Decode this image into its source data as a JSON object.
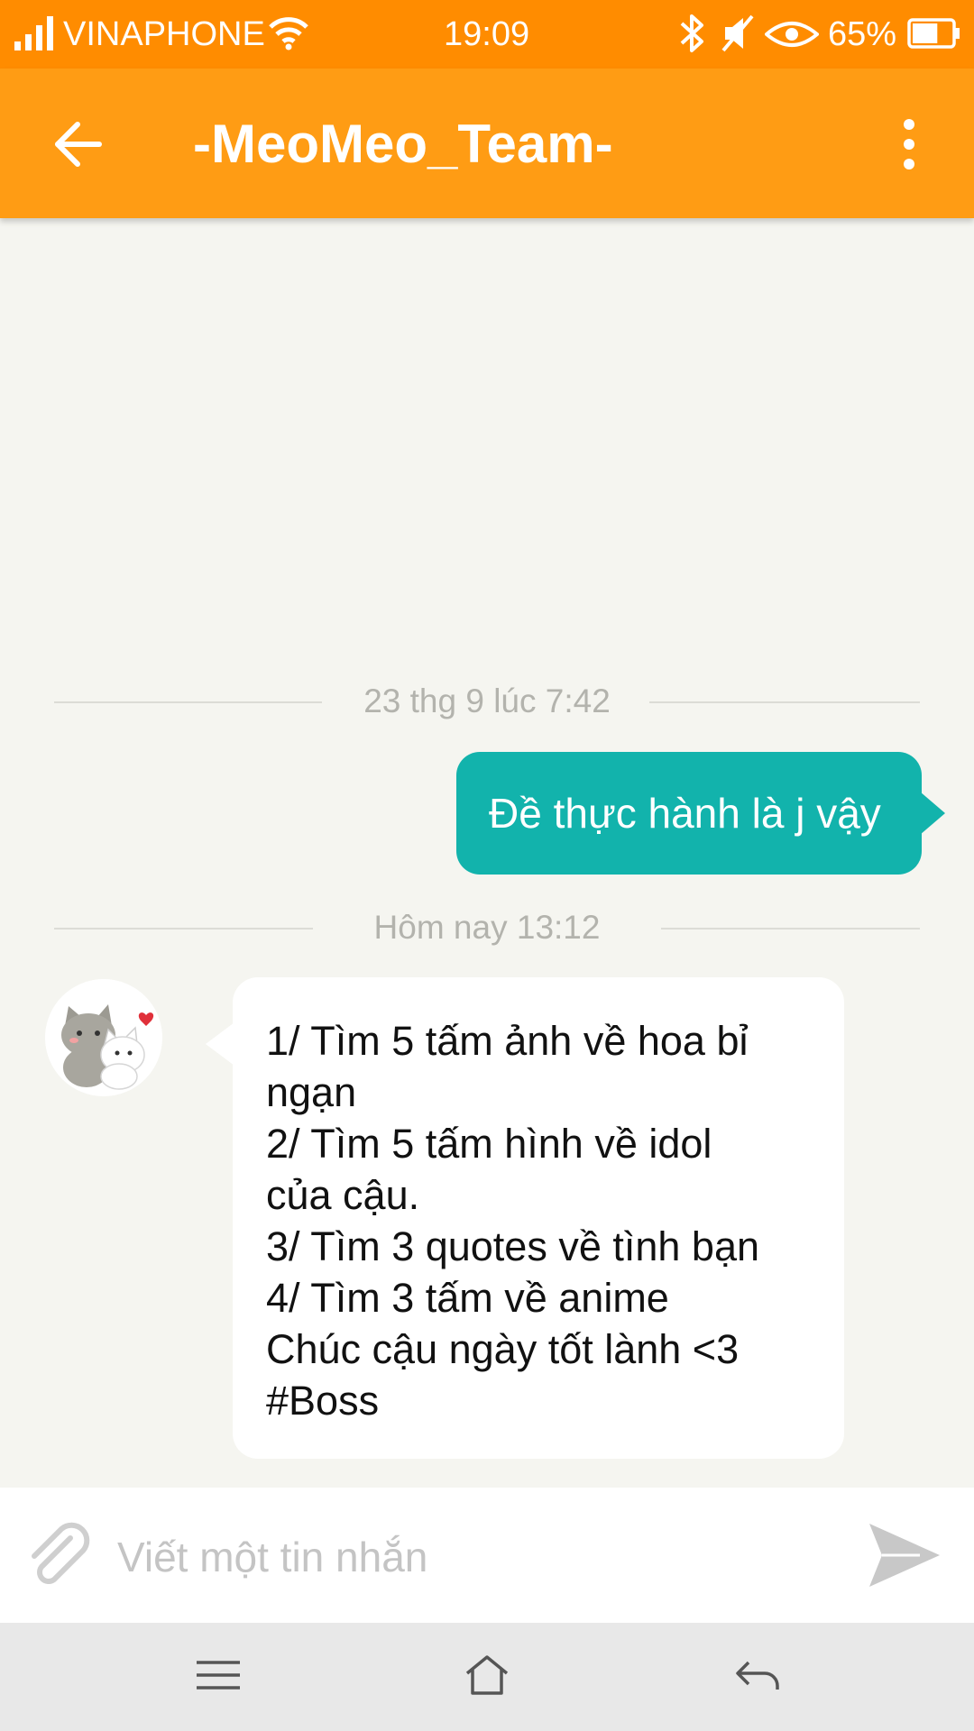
{
  "status_bar": {
    "carrier": "VINAPHONE",
    "time": "19:09",
    "battery_percent": "65%",
    "battery_level": 0.65,
    "icons": [
      "signal-icon",
      "wifi-icon",
      "bluetooth-icon",
      "mute-icon",
      "eye-icon",
      "battery-icon"
    ]
  },
  "header": {
    "title": "-MeoMeo_Team-",
    "back_icon": "arrow-left-icon",
    "menu_icon": "more-vertical-icon"
  },
  "conversation": {
    "separators": [
      {
        "label": "23 thg 9 lúc 7:42"
      },
      {
        "label": "Hôm nay 13:12"
      }
    ],
    "messages": [
      {
        "direction": "outgoing",
        "text": "Đề thực hành là j vậy",
        "bubble_color": "#12b3ac"
      },
      {
        "direction": "incoming",
        "avatar": "cat-couple-avatar",
        "lines": [
          "1/ Tìm 5 tấm ảnh về hoa bỉ",
          "ngạn",
          "2/ Tìm 5 tấm hình về idol",
          "của cậu.",
          "3/ Tìm 3 quotes về tình bạn",
          "4/ Tìm 3 tấm về anime",
          "Chúc cậu ngày tốt lành <3",
          "#Boss"
        ],
        "bubble_color": "#ffffff"
      }
    ]
  },
  "composer": {
    "placeholder": "Viết một tin nhắn",
    "value": "",
    "attach_icon": "paperclip-icon",
    "send_icon": "send-icon"
  },
  "nav_bar": {
    "items": [
      "menu-icon",
      "home-icon",
      "back-icon"
    ]
  },
  "colors": {
    "status_bar": "#ff8c00",
    "app_bar": "#ff9c14",
    "outgoing": "#12b3ac",
    "background": "#f5f5f0"
  }
}
